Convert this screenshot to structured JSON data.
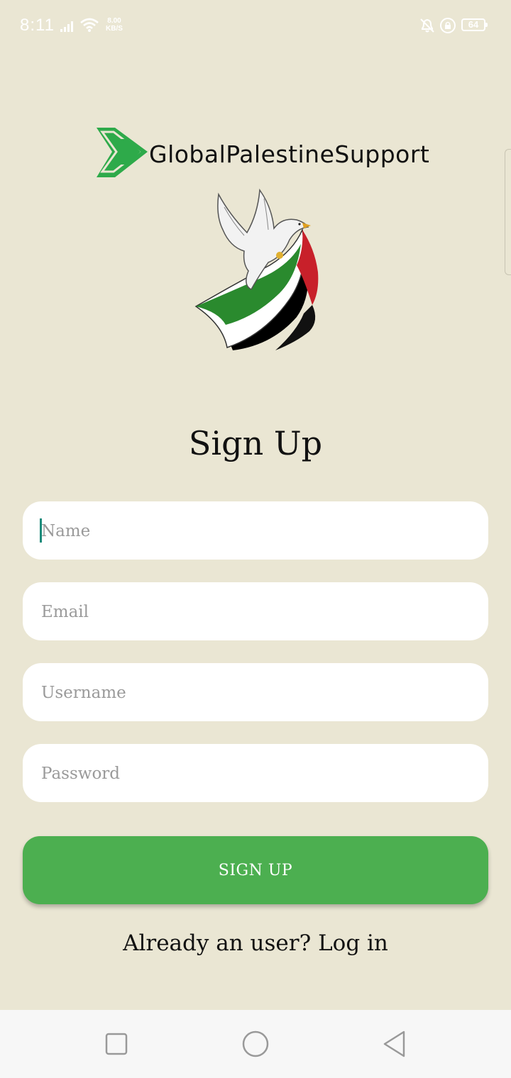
{
  "status_bar": {
    "time": "8:11",
    "net_speed_value": "8.00",
    "net_speed_unit": "KB/S",
    "battery": "64",
    "icons": [
      "signal-icon",
      "wifi-icon",
      "bell-muted-icon",
      "lock-rotation-icon",
      "battery-icon"
    ]
  },
  "logo": {
    "text": "GlobalPalestineSupport",
    "icon": "green-arrow-icon",
    "brand_color": "#2eaa4a"
  },
  "illustration": "dove-with-palestine-flag",
  "form": {
    "title": "Sign Up",
    "name_placeholder": "Name",
    "email_placeholder": "Email",
    "username_placeholder": "Username",
    "password_placeholder": "Password",
    "submit_label": "SIGN UP",
    "login_prompt": "Already an user? Log in"
  },
  "colors": {
    "background": "#eae6d3",
    "button": "#4caf50",
    "field": "#ffffff"
  },
  "nav_bar": {
    "icons": [
      "square-recents-icon",
      "circle-home-icon",
      "triangle-back-icon"
    ]
  }
}
